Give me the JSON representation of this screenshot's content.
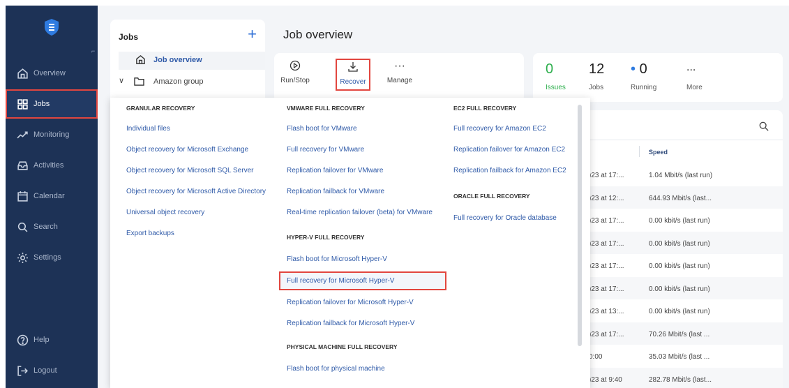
{
  "sidebar": {
    "items": [
      {
        "label": "Overview",
        "icon": "home-icon"
      },
      {
        "label": "Jobs",
        "icon": "grid-icon"
      },
      {
        "label": "Monitoring",
        "icon": "chart-icon"
      },
      {
        "label": "Activities",
        "icon": "inbox-icon"
      },
      {
        "label": "Calendar",
        "icon": "calendar-icon"
      },
      {
        "label": "Search",
        "icon": "search-icon"
      },
      {
        "label": "Settings",
        "icon": "gear-icon"
      }
    ],
    "help": "Help",
    "logout": "Logout"
  },
  "jobs_panel": {
    "title": "Jobs",
    "add": "+",
    "tree": {
      "job_overview": "Job overview",
      "amazon_group": "Amazon group"
    }
  },
  "header": {
    "title": "Job overview"
  },
  "toolbar": {
    "run_stop": "Run/Stop",
    "recover": "Recover",
    "manage": "Manage"
  },
  "stats": {
    "issues": {
      "value": "0",
      "label": "Issues"
    },
    "jobs": {
      "value": "12",
      "label": "Jobs"
    },
    "running": {
      "value": "0",
      "label": "Running"
    },
    "more": {
      "value": "...",
      "label": "More"
    }
  },
  "table": {
    "column_speed": "Speed",
    "rows": [
      {
        "date": ")23 at 17:...",
        "speed": "1.04 Mbit/s (last run)"
      },
      {
        "date": ")23 at 12:...",
        "speed": "644.93 Mbit/s (last..."
      },
      {
        "date": ")23 at 17:...",
        "speed": "0.00 kbit/s (last run)"
      },
      {
        "date": ")23 at 17:...",
        "speed": "0.00 kbit/s (last run)"
      },
      {
        "date": ")23 at 17:...",
        "speed": "0.00 kbit/s (last run)"
      },
      {
        "date": ")23 at 17:...",
        "speed": "0.00 kbit/s (last run)"
      },
      {
        "date": ")23 at 13:...",
        "speed": "0.00 kbit/s (last run)"
      },
      {
        "date": ")23 at 17:...",
        "speed": "70.26 Mbit/s (last ..."
      },
      {
        "date": "0:00",
        "speed": "35.03 Mbit/s (last ..."
      },
      {
        "date": ")23 at 9:40",
        "speed": "282.78 Mbit/s (last..."
      }
    ]
  },
  "recover_menu": {
    "granular": {
      "heading": "GRANULAR RECOVERY",
      "items": [
        "Individual files",
        "Object recovery for Microsoft Exchange",
        "Object recovery for Microsoft SQL Server",
        "Object recovery for Microsoft Active Directory",
        "Universal object recovery",
        "Export backups"
      ]
    },
    "vmware": {
      "heading": "VMWARE FULL RECOVERY",
      "items": [
        "Flash boot for VMware",
        "Full recovery for VMware",
        "Replication failover for VMware",
        "Replication failback for VMware",
        "Real-time replication failover (beta) for VMware"
      ]
    },
    "hyperv": {
      "heading": "HYPER-V FULL RECOVERY",
      "items": [
        "Flash boot for Microsoft Hyper-V",
        "Full recovery for Microsoft Hyper-V",
        "Replication failover for Microsoft Hyper-V",
        "Replication failback for Microsoft Hyper-V"
      ]
    },
    "physical": {
      "heading": "PHYSICAL MACHINE FULL RECOVERY",
      "items": [
        "Flash boot for physical machine"
      ]
    },
    "ec2": {
      "heading": "EC2 FULL RECOVERY",
      "items": [
        "Full recovery for Amazon EC2",
        "Replication failover for Amazon EC2",
        "Replication failback for Amazon EC2"
      ]
    },
    "oracle": {
      "heading": "ORACLE FULL RECOVERY",
      "items": [
        "Full recovery for Oracle database"
      ]
    }
  },
  "colors": {
    "sidebar_bg": "#1d3256",
    "accent": "#2f5aa8",
    "highlight": "#e2463f",
    "success": "#2cae4c"
  }
}
